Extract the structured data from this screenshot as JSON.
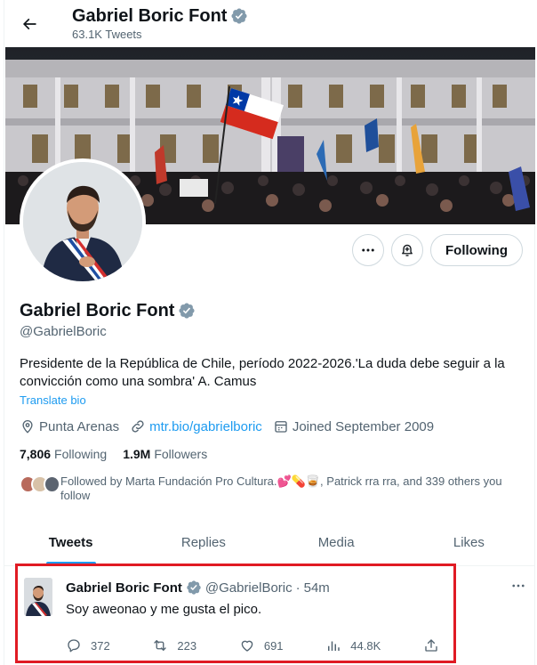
{
  "header": {
    "name": "Gabriel Boric Font",
    "tweet_count": "63.1K Tweets"
  },
  "profile": {
    "name": "Gabriel Boric Font",
    "handle": "@GabrielBoric",
    "bio": "Presidente de la República de Chile, período 2022-2026.'La duda debe seguir a la convicción como una sombra' A. Camus",
    "translate_label": "Translate bio",
    "location": "Punta Arenas",
    "website": "mtr.bio/gabrielboric",
    "joined": "Joined September 2009",
    "following_count": "7,806",
    "following_label": "Following",
    "followers_count": "1.9M",
    "followers_label": "Followers",
    "followed_by": "Followed by Marta Fundación Pro Cultura.💕💊🥃, Patrick rra rra, and 339 others you follow"
  },
  "actions": {
    "following_button": "Following"
  },
  "tabs": [
    {
      "label": "Tweets",
      "active": true
    },
    {
      "label": "Replies",
      "active": false
    },
    {
      "label": "Media",
      "active": false
    },
    {
      "label": "Likes",
      "active": false
    }
  ],
  "tweet": {
    "name": "Gabriel Boric Font",
    "handle": "@GabrielBoric",
    "separator": "·",
    "time": "54m",
    "text": "Soy aweonao y me gusta el pico.",
    "replies": "372",
    "retweets": "223",
    "likes": "691",
    "views": "44.8K"
  },
  "colors": {
    "accent": "#1d9bf0",
    "verified": "#829aab",
    "highlight_border": "#e01b24"
  }
}
